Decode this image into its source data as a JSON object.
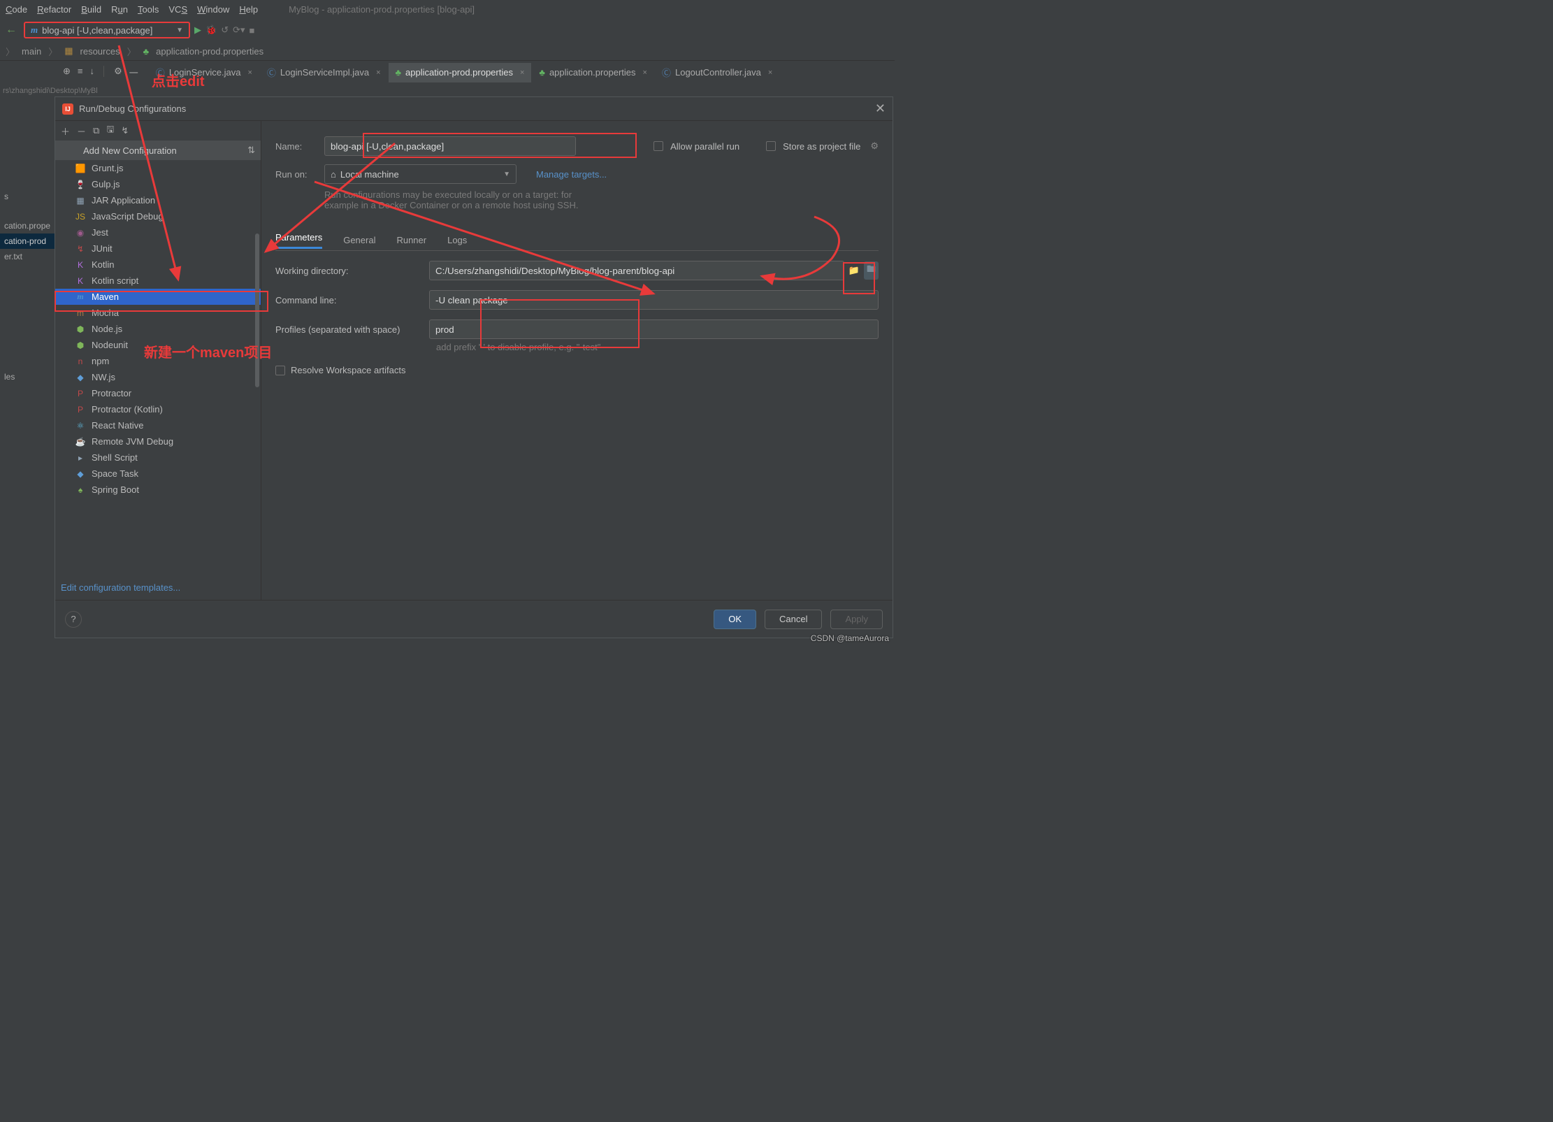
{
  "window_title": "MyBlog - application-prod.properties [blog-api]",
  "menus": {
    "code": "Code",
    "refactor": "Refactor",
    "build": "Build",
    "run": "Run",
    "tools": "Tools",
    "vcs": "VCS",
    "window": "Window",
    "help": "Help"
  },
  "run_config_label": "blog-api [-U,clean,package]",
  "breadcrumbs": {
    "main": "main",
    "resources": "resources",
    "file": "application-prod.properties"
  },
  "tabs": [
    {
      "label": "LoginService.java"
    },
    {
      "label": "LoginServiceImpl.java"
    },
    {
      "label": "application-prod.properties",
      "active": true
    },
    {
      "label": "application.properties"
    },
    {
      "label": "LogoutController.java"
    }
  ],
  "left_files": {
    "f1": "cation.prope",
    "f2": "cation-prod",
    "f3": "er.txt"
  },
  "dialog": {
    "title": "Run/Debug Configurations",
    "add_header": "Add New Configuration",
    "items": [
      {
        "label": "Grunt.js",
        "ic": "🟧"
      },
      {
        "label": "Gulp.js",
        "ic": "🍷"
      },
      {
        "label": "JAR Application",
        "ic": "▦"
      },
      {
        "label": "JavaScript Debug",
        "ic": "JS"
      },
      {
        "label": "Jest",
        "ic": "◉"
      },
      {
        "label": "JUnit",
        "ic": "↯"
      },
      {
        "label": "Kotlin",
        "ic": "K"
      },
      {
        "label": "Kotlin script",
        "ic": "K"
      },
      {
        "label": "Maven",
        "ic": "m",
        "selected": true
      },
      {
        "label": "Mocha",
        "ic": "m"
      },
      {
        "label": "Node.js",
        "ic": "⬢"
      },
      {
        "label": "Nodeunit",
        "ic": "⬢"
      },
      {
        "label": "npm",
        "ic": "n"
      },
      {
        "label": "NW.js",
        "ic": "◆"
      },
      {
        "label": "Protractor",
        "ic": "P"
      },
      {
        "label": "Protractor (Kotlin)",
        "ic": "P"
      },
      {
        "label": "React Native",
        "ic": "⚛"
      },
      {
        "label": "Remote JVM Debug",
        "ic": "☕"
      },
      {
        "label": "Shell Script",
        "ic": "▸"
      },
      {
        "label": "Space Task",
        "ic": "◆"
      },
      {
        "label": "Spring Boot",
        "ic": "♠"
      }
    ],
    "edit_templates": "Edit configuration templates...",
    "name_label": "Name:",
    "name_value": "blog-api [-U,clean,package]",
    "allow_parallel": "Allow parallel run",
    "store_project": "Store as project file",
    "run_on_label": "Run on:",
    "run_on_value": "Local machine",
    "manage_targets": "Manage targets...",
    "hint1": "Run configurations may be executed locally or on a target: for",
    "hint2": "example in a Docker Container or on a remote host using SSH.",
    "subtabs": {
      "parameters": "Parameters",
      "general": "General",
      "runner": "Runner",
      "logs": "Logs"
    },
    "working_dir_label": "Working directory:",
    "working_dir": "C:/Users/zhangshidi/Desktop/MyBlog/blog-parent/blog-api",
    "cmd_label": "Command line:",
    "cmd": "-U clean package",
    "profiles_label": "Profiles (separated with space)",
    "profiles": "prod",
    "profiles_hint": "add prefix '-' to disable profile, e.g. \"-test\"",
    "resolve": "Resolve Workspace artifacts",
    "ok": "OK",
    "cancel": "Cancel",
    "apply": "Apply"
  },
  "annot": {
    "edit": "点击edit",
    "new_maven": "新建一个maven项目"
  },
  "watermark": "CSDN @tameAurora"
}
